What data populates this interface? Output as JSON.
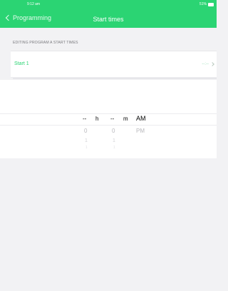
{
  "status_bar": {
    "time": "9:12 am",
    "battery": "51%"
  },
  "nav": {
    "back_label": "Programming",
    "title": "Start times"
  },
  "section": {
    "header": "EDITING PROGRAM A START TIMES"
  },
  "start_row": {
    "label": "Start 1",
    "value": "--:--"
  },
  "picker": {
    "hour_selected": "--",
    "hour_unit": "h",
    "minute_selected": "--",
    "minute_unit": "m",
    "period_selected": "AM",
    "period_next": "PM",
    "hour_below": [
      "0",
      "1",
      "1"
    ],
    "minute_below": [
      "0",
      "1",
      "1"
    ]
  },
  "colors": {
    "accent": "#2bd473",
    "background": "#f2f2f4"
  }
}
